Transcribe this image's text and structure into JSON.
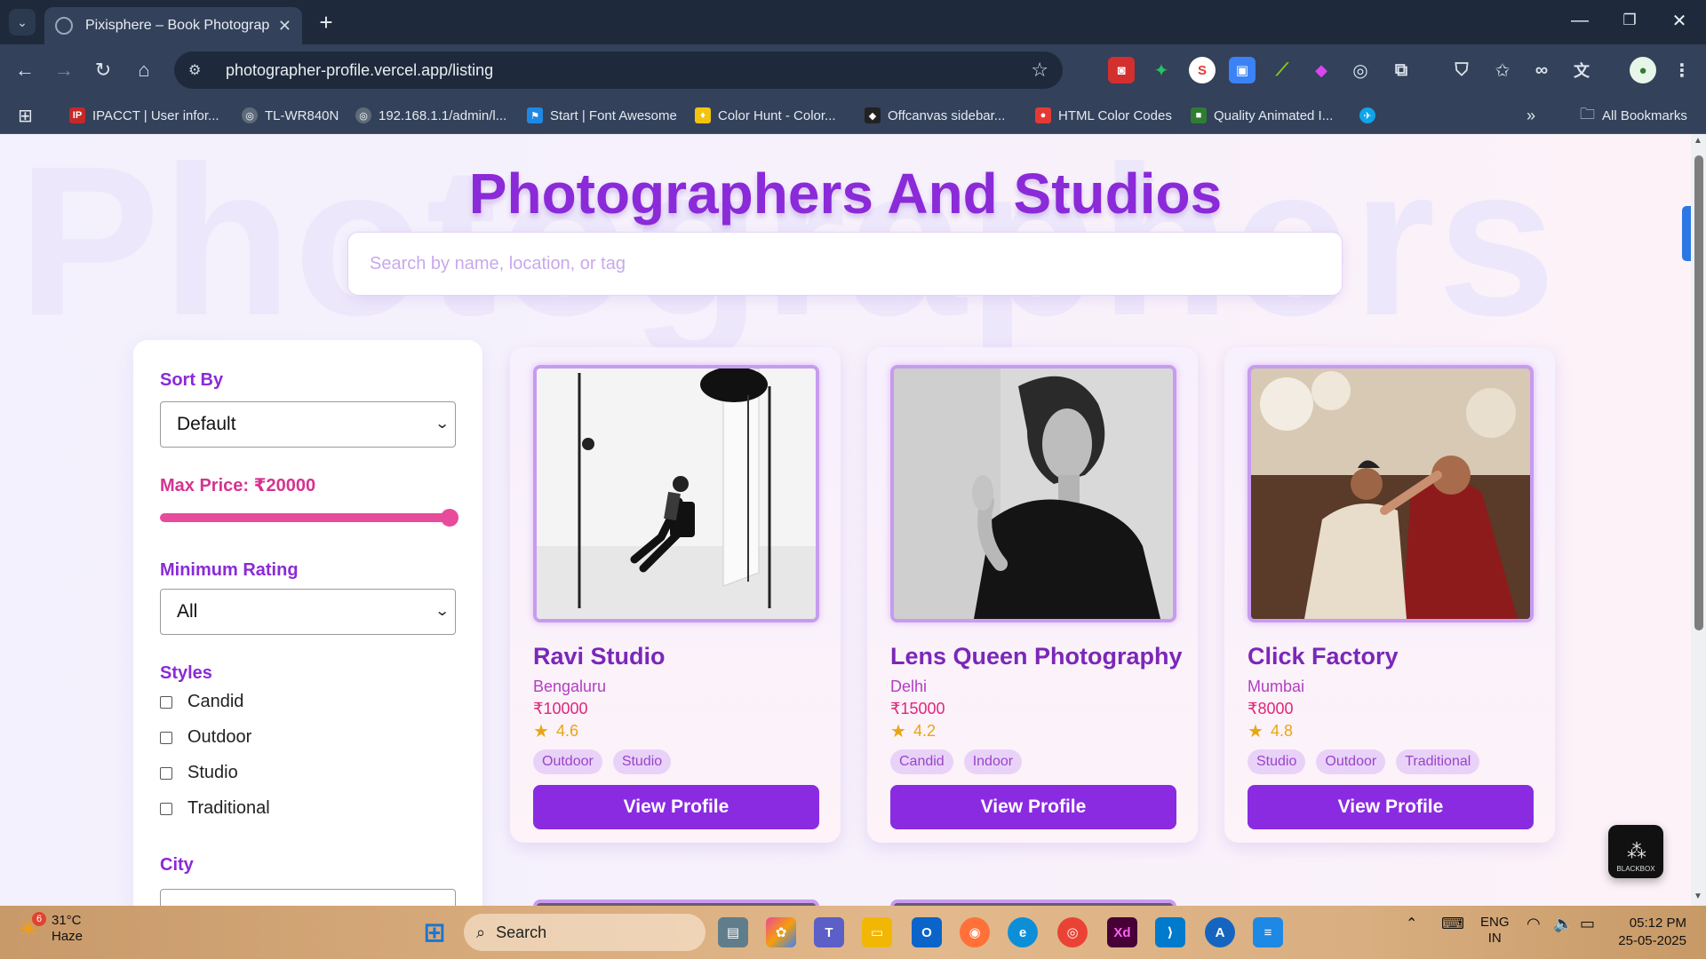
{
  "browser": {
    "tab_title": "Pixisphere – Book Photographe",
    "url": "photographer-profile.vercel.app/listing",
    "bookmarks": [
      {
        "label": "IPACCT | User infor...",
        "icon_color": "#c62828",
        "icon_text": "IP"
      },
      {
        "label": "TL-WR840N",
        "icon_color": "#5f6b7a",
        "icon_text": "◎"
      },
      {
        "label": "192.168.1.1/admin/l...",
        "icon_color": "#5f6b7a",
        "icon_text": "◎"
      },
      {
        "label": "Start | Font Awesome",
        "icon_color": "#1e88e5",
        "icon_text": "⚑"
      },
      {
        "label": "Color Hunt - Color...",
        "icon_color": "#f1c40f",
        "icon_text": "♦"
      },
      {
        "label": "Offcanvas sidebar...",
        "icon_color": "#222222",
        "icon_text": "◆"
      },
      {
        "label": "HTML Color Codes",
        "icon_color": "#e53935",
        "icon_text": "●"
      },
      {
        "label": "Quality Animated I...",
        "icon_color": "#2e7d32",
        "icon_text": "■"
      }
    ],
    "all_bookmarks": "All Bookmarks"
  },
  "page": {
    "watermark": "Photographers",
    "title": "Photographers And Studios",
    "search_placeholder": "Search by name, location, or tag"
  },
  "filters": {
    "sort_label": "Sort By",
    "sort_value": "Default",
    "price_label": "Max Price: ₹20000",
    "price_fraction": 1.0,
    "rating_label": "Minimum Rating",
    "rating_value": "All",
    "styles_label": "Styles",
    "styles": [
      "Candid",
      "Outdoor",
      "Studio",
      "Traditional"
    ],
    "city_label": "City"
  },
  "cards": [
    {
      "name": "Ravi Studio",
      "city": "Bengaluru",
      "price": "₹10000",
      "rating": "4.6",
      "tags": [
        "Outdoor",
        "Studio"
      ],
      "button": "View Profile"
    },
    {
      "name": "Lens Queen Photography",
      "city": "Delhi",
      "price": "₹15000",
      "rating": "4.2",
      "tags": [
        "Candid",
        "Indoor"
      ],
      "button": "View Profile"
    },
    {
      "name": "Click Factory",
      "city": "Mumbai",
      "price": "₹8000",
      "rating": "4.8",
      "tags": [
        "Studio",
        "Outdoor",
        "Traditional"
      ],
      "button": "View Profile"
    }
  ],
  "widget": {
    "label": "BLACKBOX"
  },
  "taskbar": {
    "weather_badge": "6",
    "temperature": "31°C",
    "condition": "Haze",
    "search": "Search",
    "lang_top": "ENG",
    "lang_bottom": "IN",
    "time": "05:12 PM",
    "date": "25-05-2025"
  },
  "colors": {
    "accent_purple": "#8a2be2",
    "title_purple": "#8a2ad8",
    "price_pink": "#e0267a",
    "rating_gold": "#e8a612"
  }
}
